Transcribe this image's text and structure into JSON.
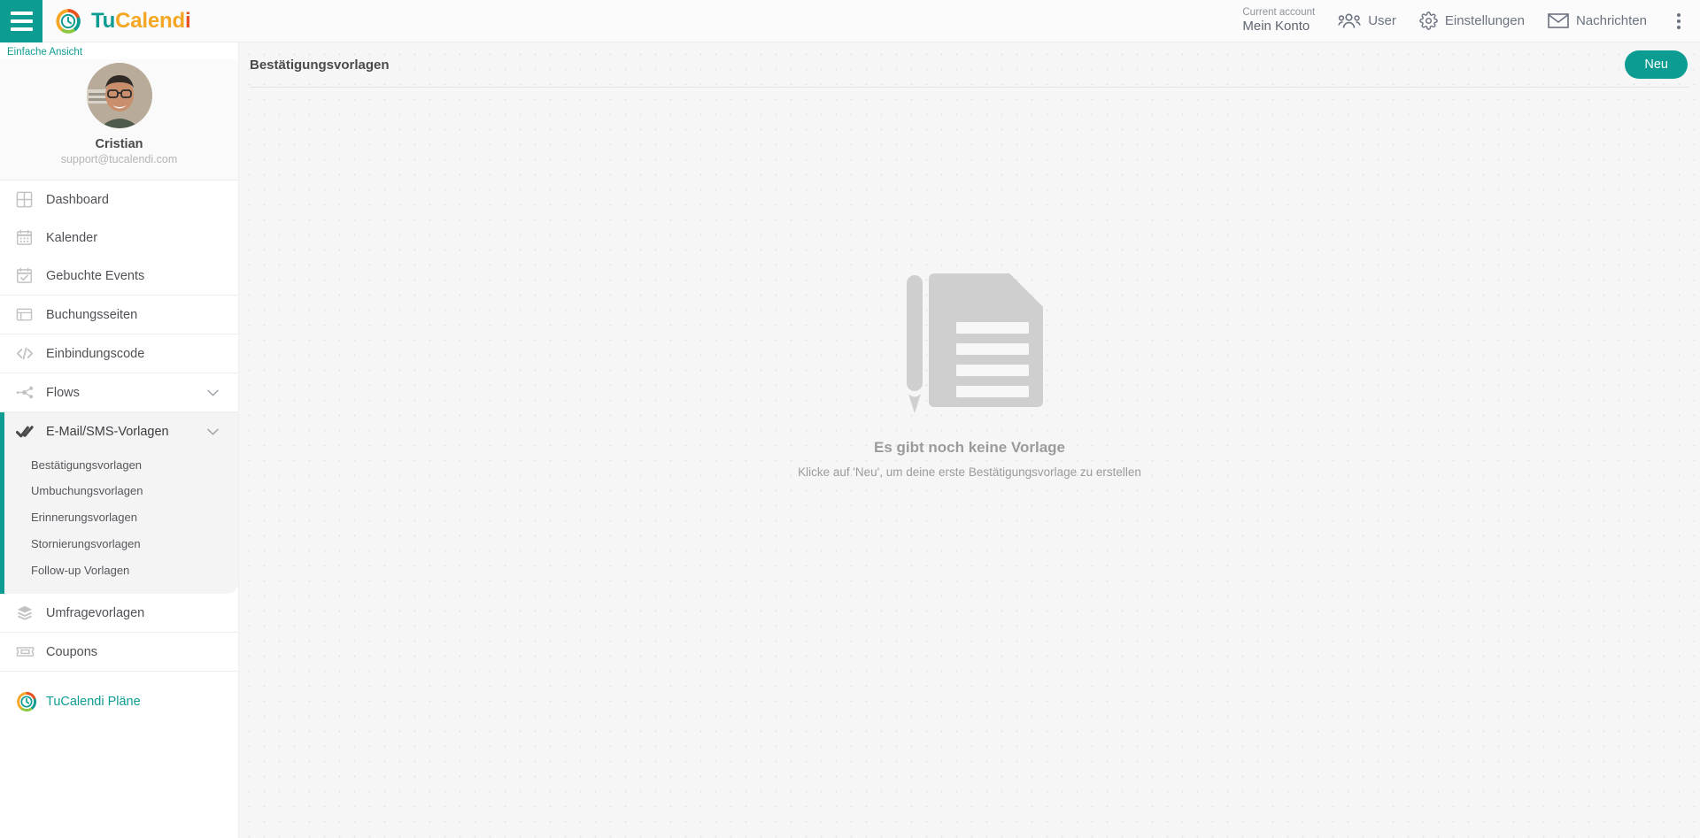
{
  "topbar": {
    "hamburger_icon": "hamburger-menu-icon",
    "brand": {
      "part1": "Tu",
      "part2": "Calend",
      "part3": "i"
    },
    "account": {
      "small_label": "Current account",
      "name": "Mein Konto"
    },
    "items": [
      {
        "label": "User",
        "icon": "users-icon"
      },
      {
        "label": "Einstellungen",
        "icon": "gear-icon"
      },
      {
        "label": "Nachrichten",
        "icon": "envelope-icon"
      }
    ],
    "overflow_icon": "kebab-menu-icon"
  },
  "sidebar": {
    "simple_view": "Einfache Ansicht",
    "profile": {
      "name": "Cristian",
      "email": "support@tucalendi.com",
      "avatar": "user-photo-avatar"
    },
    "groups": [
      {
        "items": [
          {
            "label": "Dashboard",
            "icon": "grid-icon"
          },
          {
            "label": "Kalender",
            "icon": "calendar-icon"
          },
          {
            "label": "Gebuchte Events",
            "icon": "calendar-check-icon"
          }
        ]
      },
      {
        "items": [
          {
            "label": "Buchungsseiten",
            "icon": "browser-window-icon"
          }
        ]
      },
      {
        "items": [
          {
            "label": "Einbindungscode",
            "icon": "code-brackets-icon"
          }
        ]
      },
      {
        "items": [
          {
            "label": "Flows",
            "icon": "flow-nodes-icon",
            "expandable": true
          }
        ]
      }
    ],
    "active_group": {
      "label": "E-Mail/SMS-Vorlagen",
      "icon": "double-check-icon",
      "expandable": true,
      "subitems": [
        "Bestätigungsvorlagen",
        "Umbuchungsvorlagen",
        "Erinnerungsvorlagen",
        "Stornierungsvorlagen",
        "Follow-up Vorlagen"
      ]
    },
    "groups_after": [
      {
        "items": [
          {
            "label": "Umfragevorlagen",
            "icon": "layers-icon"
          }
        ]
      },
      {
        "items": [
          {
            "label": "Coupons",
            "icon": "ticket-icon"
          }
        ]
      }
    ],
    "plans": {
      "label": "TuCalendi Pläne",
      "icon": "tucalendi-logo-icon"
    }
  },
  "main": {
    "page_title": "Bestätigungsvorlagen",
    "new_button": "Neu",
    "empty_state": {
      "illustration": "document-with-pencil-illustration",
      "title": "Es gibt noch keine Vorlage",
      "subtitle": "Klicke auf 'Neu', um deine erste Bestätigungsvorlage zu erstellen"
    }
  },
  "colors": {
    "accent_teal": "#0d9c92",
    "brand_orange": "#f5a623",
    "brand_red": "#e8521f",
    "brand_green": "#8dc63f"
  }
}
